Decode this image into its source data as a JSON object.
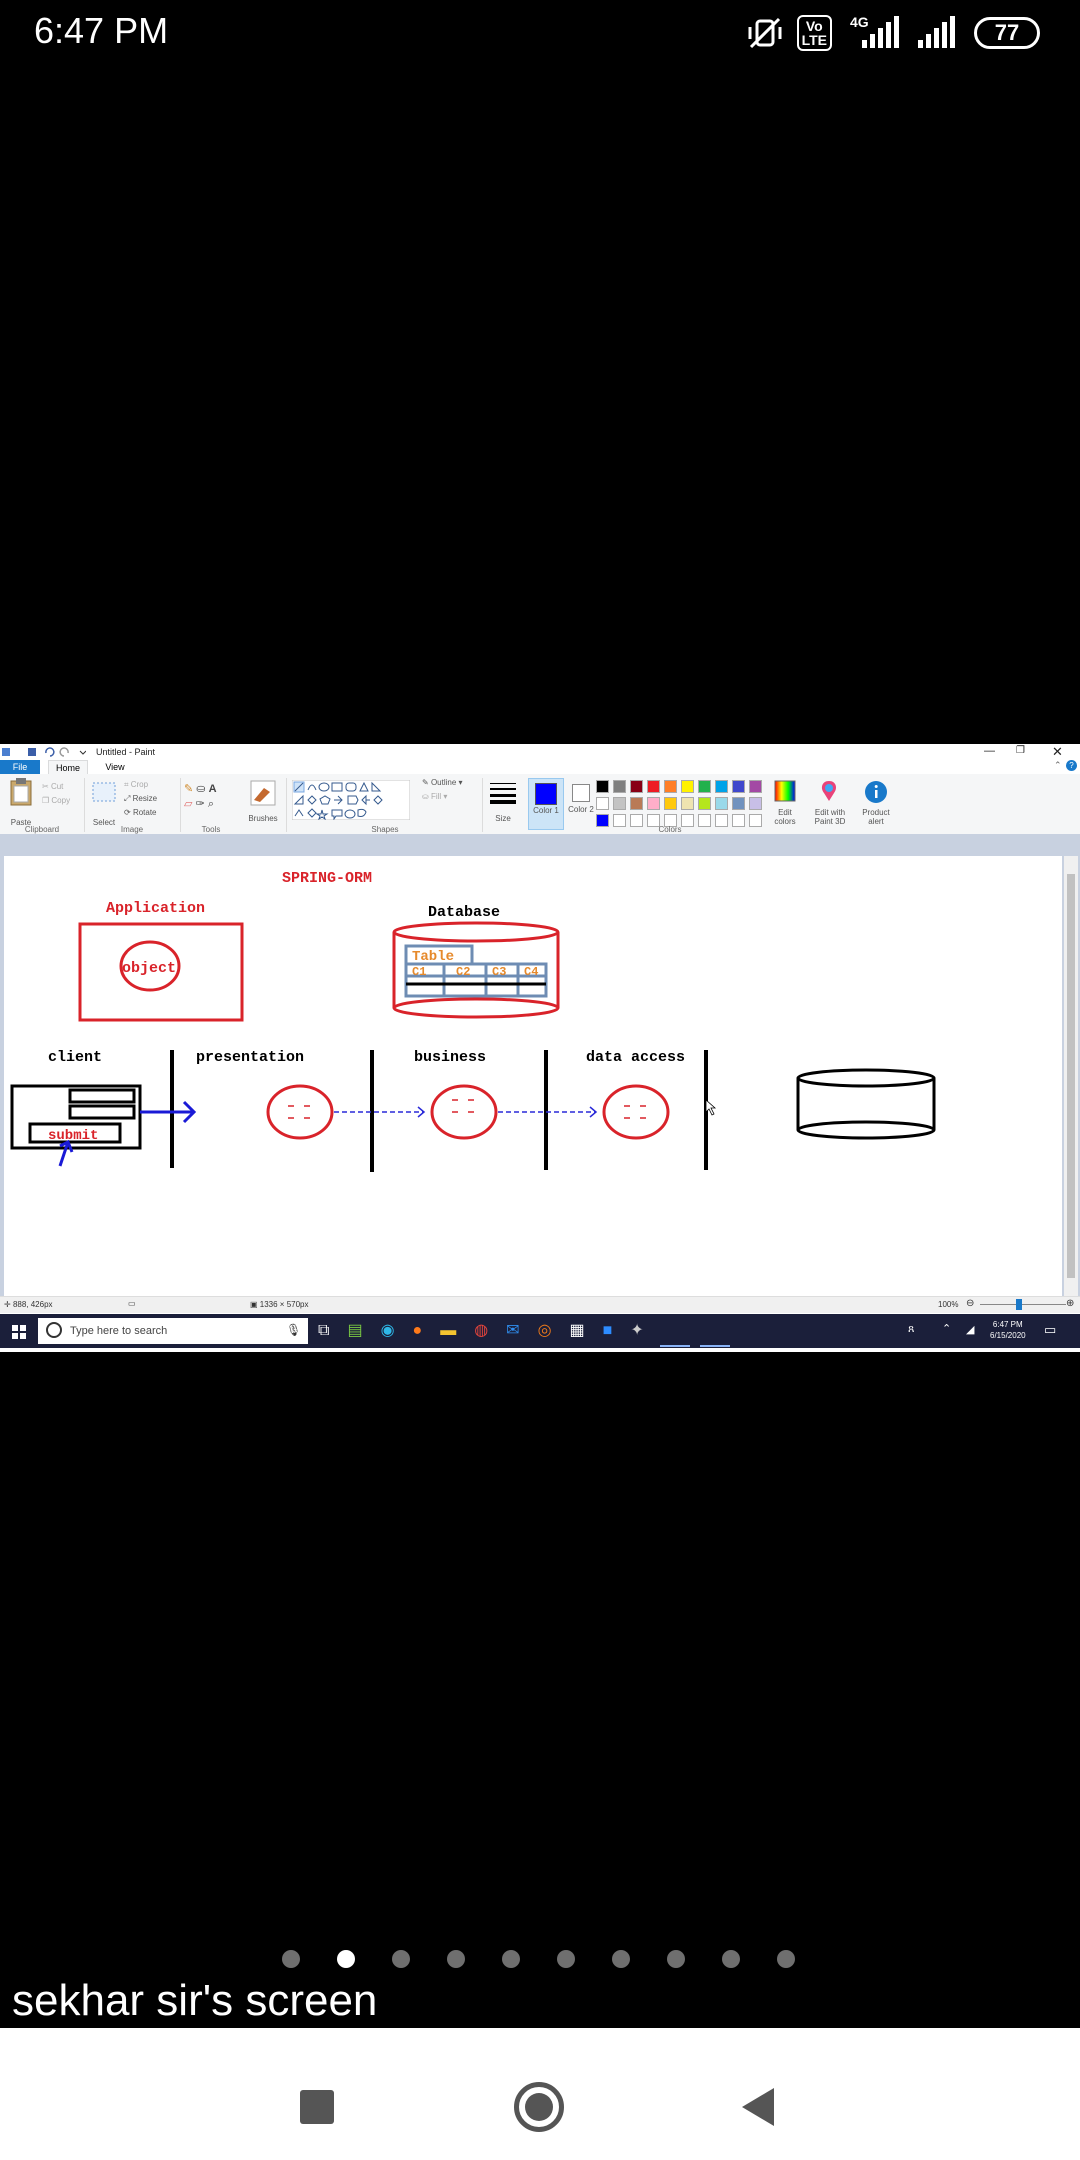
{
  "status_bar": {
    "time": "6:47 PM",
    "volte_label": "Vo\nLTE",
    "network_label": "4G",
    "battery": "77"
  },
  "paint": {
    "window_title": "Untitled - Paint",
    "menu": [
      "File",
      "Home",
      "View"
    ],
    "ribbon": {
      "paste": "Paste",
      "cut": "Cut",
      "copy": "Copy",
      "select": "Select",
      "crop": "Crop",
      "resize": "Resize",
      "rotate": "Rotate",
      "brushes": "Brushes",
      "outline": "Outline",
      "fill": "Fill",
      "size": "Size",
      "color1": "Color 1",
      "color2": "Color 2",
      "edit_colors": "Edit colors",
      "edit_paint3d": "Edit with Paint 3D",
      "product_alert": "Product alert",
      "groups": [
        "Clipboard",
        "Image",
        "Tools",
        "Shapes",
        "Colors"
      ]
    },
    "palette_row1": [
      "#000000",
      "#7f7f7f",
      "#880015",
      "#ed1c24",
      "#ff7f27",
      "#fff200",
      "#22b14c",
      "#00a2e8",
      "#3f48cc",
      "#a349a4"
    ],
    "palette_row2": [
      "#ffffff",
      "#c3c3c3",
      "#b97a57",
      "#ffaec9",
      "#ffc90e",
      "#efe4b0",
      "#b5e61d",
      "#99d9ea",
      "#7092be",
      "#c8bfe7"
    ],
    "palette_row3": [
      "#0000ff",
      "#ffffff",
      "#ffffff",
      "#ffffff",
      "#ffffff",
      "#ffffff",
      "#ffffff",
      "#ffffff",
      "#ffffff",
      "#ffffff"
    ],
    "canvas": {
      "title": "SPRING-ORM",
      "application": "Application",
      "object": "object",
      "database": "Database",
      "table": "Table",
      "columns": [
        "C1",
        "C2",
        "C3",
        "C4"
      ],
      "layers": [
        "client",
        "presentation",
        "business",
        "data access"
      ],
      "submit": "submit"
    },
    "status": {
      "cursor": "888, 426px",
      "dimensions": "1336 × 570px",
      "zoom": "100%"
    },
    "taskbar": {
      "search_placeholder": "Type here to search",
      "time": "6:47 PM",
      "date": "6/15/2020"
    }
  },
  "pager": {
    "total": 10,
    "active": 1
  },
  "caption": "sekhar sir's screen"
}
